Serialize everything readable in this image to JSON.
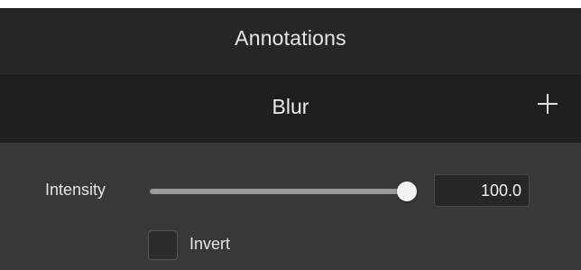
{
  "panel": {
    "title": "Annotations"
  },
  "section": {
    "title": "Blur",
    "add_icon": "plus-icon"
  },
  "intensity": {
    "label": "Intensity",
    "value": "100.0",
    "slider_fraction": 1.0
  },
  "invert": {
    "label": "Invert",
    "checked": false
  },
  "colors": {
    "panel_bg": "#262626",
    "section_bg": "#1f1f1f",
    "content_bg": "#383838",
    "text": "#e4e4e4"
  }
}
